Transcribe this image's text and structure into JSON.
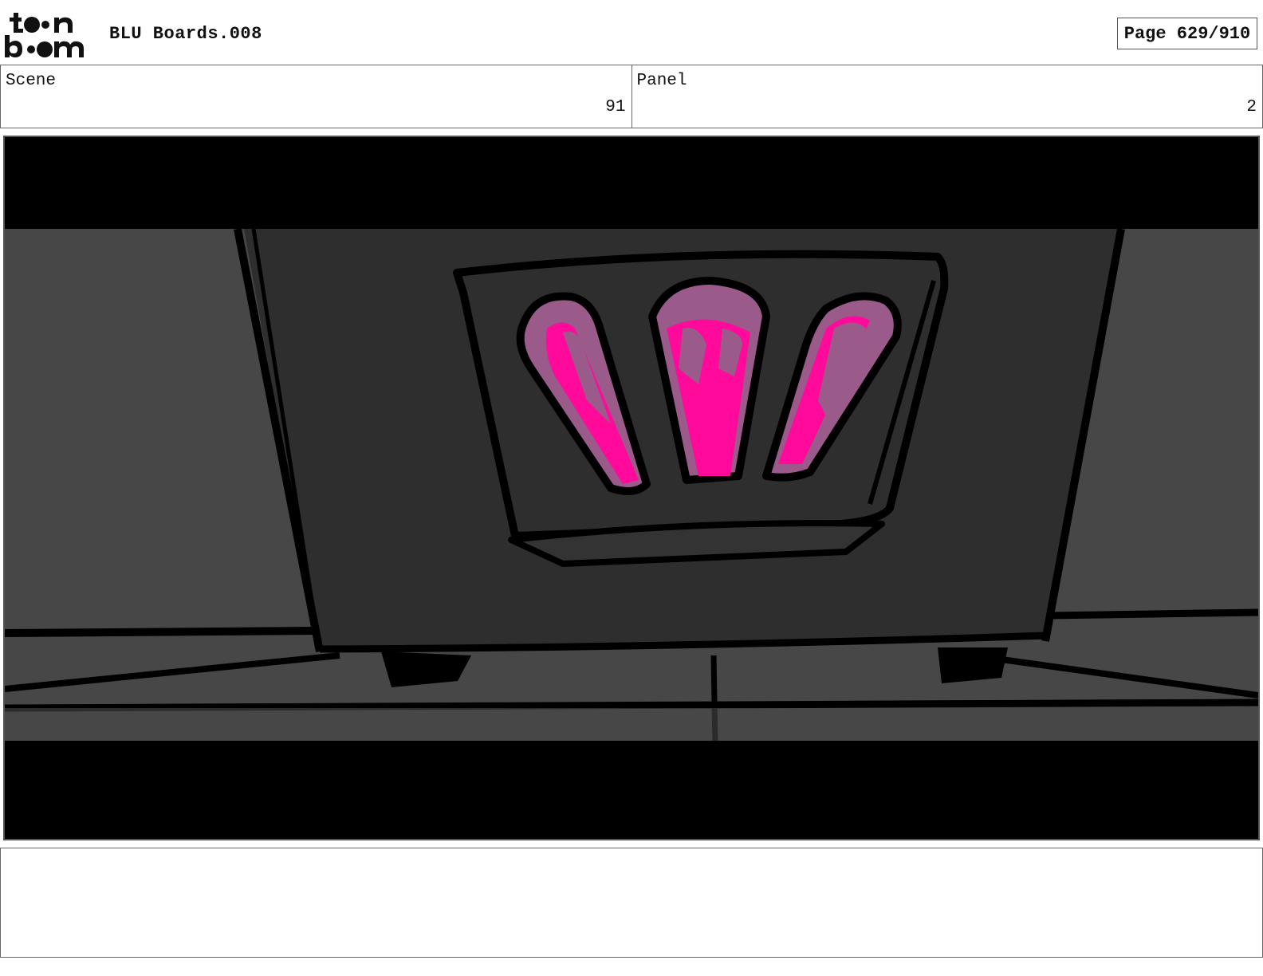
{
  "header": {
    "logo_text_top": "toon",
    "logo_text_bottom": "boom",
    "document_title": "BLU Boards.008",
    "page_indicator": "Page 629/910"
  },
  "info": {
    "scene_label": "Scene",
    "scene_value": "91",
    "panel_label": "Panel",
    "panel_value": "2"
  },
  "notes": {
    "text": ""
  },
  "colors": {
    "glow_pink": "#ff0a9a",
    "glow_mauve": "#9a5a8a",
    "toaster_body": "#2e2e2e",
    "background_gray": "#474747",
    "letterbox": "#000000"
  }
}
